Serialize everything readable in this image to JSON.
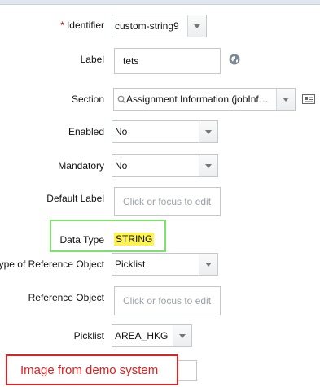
{
  "form": {
    "identifier": {
      "label": "Identifier",
      "required_mark": "*",
      "value": "custom-string9"
    },
    "label_field": {
      "label": "Label",
      "value": "tets"
    },
    "section": {
      "label": "Section",
      "value": "Assignment Information (jobInf…"
    },
    "enabled": {
      "label": "Enabled",
      "value": "No"
    },
    "mandatory": {
      "label": "Mandatory",
      "value": "No"
    },
    "default_label": {
      "label": "Default Label",
      "placeholder": "Click or focus to edit"
    },
    "data_type": {
      "label": "Data Type",
      "value": "STRING"
    },
    "reference_type": {
      "label": "ype of Reference Object",
      "value": "Picklist"
    },
    "reference_object": {
      "label": "Reference Object",
      "placeholder": "Click or focus to edit"
    },
    "picklist": {
      "label": "Picklist",
      "value": "AREA_HKG"
    }
  },
  "annotation": {
    "text": "Image from demo system"
  },
  "colors": {
    "highlight": "#fff44f",
    "green_box": "#7be36b",
    "red_box": "#e02020",
    "red_text": "#e02020"
  }
}
